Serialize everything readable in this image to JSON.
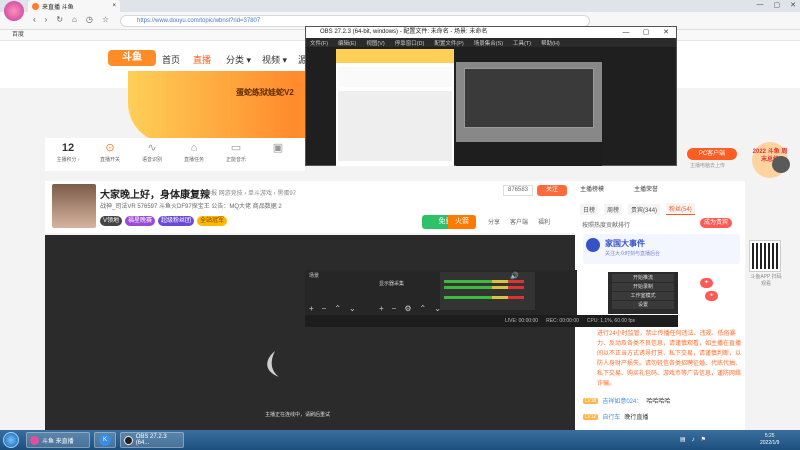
{
  "browser": {
    "tab_title": "来直播 斗鱼",
    "url": "https://www.douyu.com/topic/wbnsl?rid=37807",
    "bookmark": "百度"
  },
  "page": {
    "logo": "斗鱼",
    "nav": [
      "首页",
      "直播",
      "分类 ▾",
      "视频 ▾",
      "源"
    ],
    "banner_text": "蛋蛇练狱娃蛇V2",
    "icon_row": [
      {
        "glyph": "12",
        "label": "主播积分 ›"
      },
      {
        "glyph": "⊙",
        "label": "直播开关"
      },
      {
        "glyph": "∿",
        "label": "语音识别"
      },
      {
        "glyph": "⌂",
        "label": "直播任务"
      },
      {
        "glyph": "▭",
        "label": "正能音乐"
      },
      {
        "glyph": "▣",
        "label": ""
      }
    ],
    "pc_button": "PC客户端",
    "pc_sub": "主播电脑去上传",
    "badge_2022": "2022 斗鱼 周末总结"
  },
  "stream": {
    "title": "大家晚上好，身体康复辣",
    "tags_line": "举报  网游竞技 › 单斗游戏 › 黑蛋97",
    "fans": "876583",
    "subscribe": "关注",
    "anchor_tags": [
      "V领地",
      "福星晚赛",
      "超级粉丝团",
      "全站冠军"
    ],
    "meta": "战神_司法VR  576597  斗鱼火DF97探宝王  公告：MQ大佬  商品数据 2",
    "green_btn": "免费领",
    "fire_btn": "火箭",
    "actions": [
      "分享",
      "客户端",
      "福利"
    ],
    "offline_text": "主播正在连线中，请刷后重试"
  },
  "chat": {
    "tabs1": [
      "主播榜模",
      "主播荣誉"
    ],
    "tabs2": [
      "日榜",
      "周榜",
      "贵宾(344)",
      "粉丝(54)"
    ],
    "rank": "按照热度贡献排行",
    "sponsor_title": "家国大事件",
    "sponsor_sub": "关注大众时刻与直播后台",
    "pill": "成为贵宾",
    "notice": "进行24小时监管，禁止传播任何违法、违规、低俗暴力、反动及各类不良信息，请谨慎观看，如主播在直播间以不正当方式诱导打赏、私下交易，请谨慎判断，以防人身财产损失。请勿轻信各类招聘征婚、代练代抽、私下交易、购买礼包码、游戏币等广告信息，谨防网络诈骗。",
    "lines": [
      {
        "level": "LV18",
        "user": "吉祥如意024：",
        "msg": "哈哈哈哈"
      },
      {
        "level": "LV12",
        "user": "自行车",
        "msg": "晚行直播"
      }
    ],
    "qr_label": "斗鱼APP 扫码观看"
  },
  "obs": {
    "title": "OBS 27.2.3 (64-bit, windows) - 配置文件: 未命名 - 场景: 未命名",
    "menu": [
      "文件(F)",
      "编辑(E)",
      "视图(V)",
      "停靠窗口(D)",
      "配置文件(P)",
      "场景集合(S)",
      "工具(T)",
      "帮助(H)"
    ],
    "controls": [
      "开始推流",
      "开始录制",
      "工作室模式",
      "设置",
      "退出"
    ],
    "status": [
      "LIVE: 00:00:00",
      "REC: 00:00:00",
      "CPU: 1.1%, 60.00 fps"
    ],
    "scene": "场景",
    "source": "显示器采集"
  },
  "taskbar": {
    "items": [
      "斗鱼 来直播",
      "K",
      "OBS 27.2.3 (64..."
    ],
    "time": "5:25",
    "date": "2022/1/9"
  }
}
